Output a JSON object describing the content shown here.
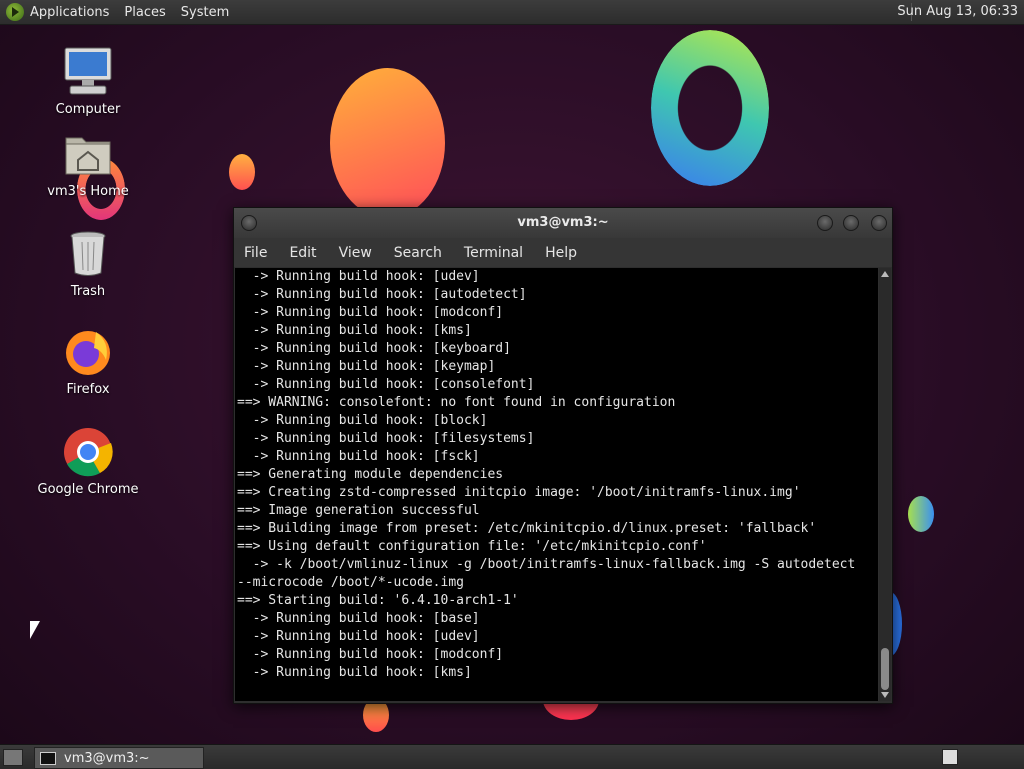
{
  "top_panel": {
    "menus": [
      "Applications",
      "Places",
      "System"
    ],
    "clock": "Sun Aug 13, 06:33"
  },
  "desktop_icons": [
    {
      "label": "Computer"
    },
    {
      "label": "vm3's Home"
    },
    {
      "label": "Trash"
    },
    {
      "label": "Firefox"
    },
    {
      "label": "Google Chrome"
    }
  ],
  "terminal": {
    "title": "vm3@vm3:~",
    "menus": [
      "File",
      "Edit",
      "View",
      "Search",
      "Terminal",
      "Help"
    ],
    "lines": [
      "  -> Running build hook: [udev]",
      "  -> Running build hook: [autodetect]",
      "  -> Running build hook: [modconf]",
      "  -> Running build hook: [kms]",
      "  -> Running build hook: [keyboard]",
      "  -> Running build hook: [keymap]",
      "  -> Running build hook: [consolefont]",
      "==> WARNING: consolefont: no font found in configuration",
      "  -> Running build hook: [block]",
      "  -> Running build hook: [filesystems]",
      "  -> Running build hook: [fsck]",
      "==> Generating module dependencies",
      "==> Creating zstd-compressed initcpio image: '/boot/initramfs-linux.img'",
      "==> Image generation successful",
      "==> Building image from preset: /etc/mkinitcpio.d/linux.preset: 'fallback'",
      "==> Using default configuration file: '/etc/mkinitcpio.conf'",
      "  -> -k /boot/vmlinuz-linux -g /boot/initramfs-linux-fallback.img -S autodetect",
      "--microcode /boot/*-ucode.img",
      "==> Starting build: '6.4.10-arch1-1'",
      "  -> Running build hook: [base]",
      "  -> Running build hook: [udev]",
      "  -> Running build hook: [modconf]",
      "  -> Running build hook: [kms]"
    ]
  },
  "taskbar": {
    "task_label": "vm3@vm3:~"
  },
  "colors": {
    "desktop_bg": "#2a0d26",
    "panel_bg": "#333333",
    "terminal_bg": "#000000",
    "terminal_fg": "#e6e6e6"
  }
}
